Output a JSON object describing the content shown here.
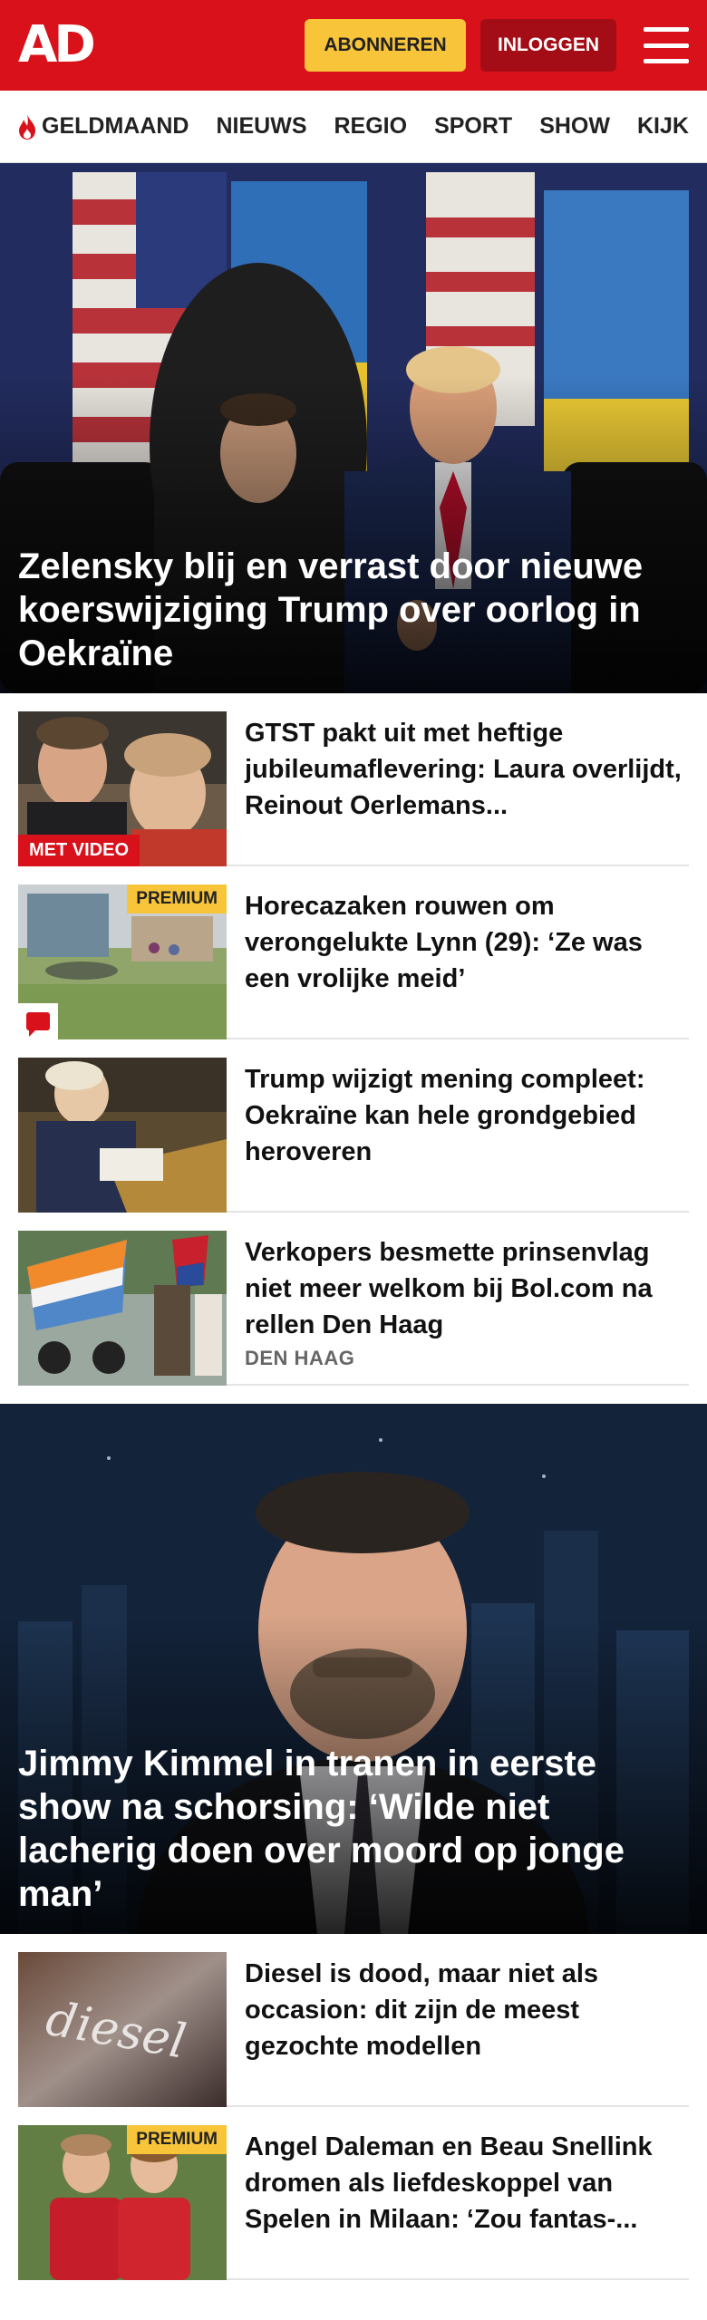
{
  "header": {
    "logo": "AD",
    "subscribe_label": "ABONNEREN",
    "login_label": "INLOGGEN"
  },
  "nav": {
    "items": [
      "GELDMAAND",
      "NIEUWS",
      "REGIO",
      "SPORT",
      "SHOW",
      "KIJK"
    ]
  },
  "hero1": {
    "title": "Zelensky blij en verrast door nieuwe koerswijziging Trump over oorlog in Oekraïne"
  },
  "list1": [
    {
      "title": "GTST pakt uit met heftige jubileumaflevering: Laura overlijdt, Reinout Oerlemans...",
      "badge": "MET VIDEO"
    },
    {
      "title": "Horecazaken rouwen om verongelukte Lynn (29): ‘Ze was een vrolijke meid’",
      "badge": "PREMIUM"
    },
    {
      "title": "Trump wijzigt mening compleet: Oekraïne kan hele grondgebied heroveren"
    },
    {
      "title": "Verkopers besmette prinsenvlag niet meer welkom bij Bol.com na rellen Den Haag",
      "tag": "DEN HAAG"
    }
  ],
  "hero2": {
    "title": "Jimmy Kimmel in tranen in eerste show na schorsing: ‘Wilde niet lacherig doen over moord op jonge man’"
  },
  "list2": [
    {
      "title": "Diesel is dood, maar niet als occasion: dit zijn de meest gezochte modellen"
    },
    {
      "title": "Angel Daleman en Beau Snellink dromen als liefdeskoppel van Spelen in Milaan: ‘Zou fantas-...",
      "badge": "PREMIUM"
    }
  ],
  "colors": {
    "brand_red": "#d8111a",
    "premium_yellow": "#f7c43a",
    "login_dark_red": "#a40d16"
  }
}
